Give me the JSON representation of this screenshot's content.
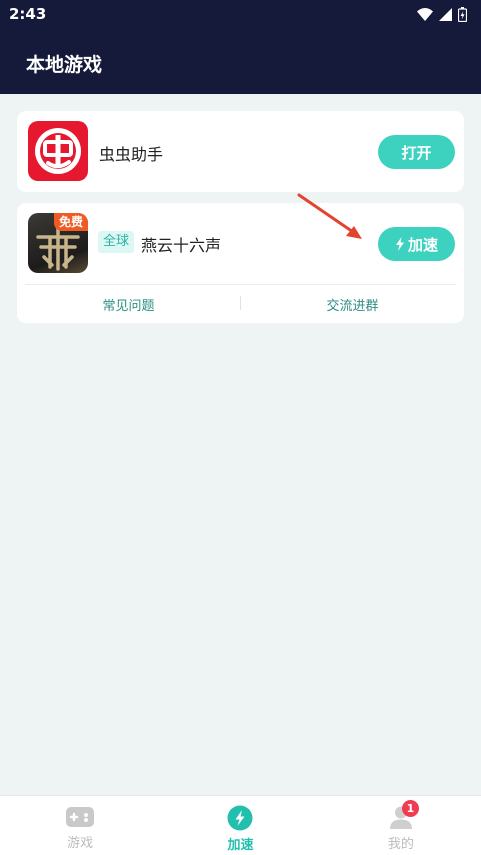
{
  "status_bar": {
    "time": "2:43",
    "icons": [
      "wifi-icon",
      "signal-icon",
      "battery-icon"
    ]
  },
  "header": {
    "title": "本地游戏"
  },
  "apps": [
    {
      "name": "虫虫助手",
      "action_label": "打开",
      "icon": "bug-assistant-logo"
    },
    {
      "name": "燕云十六声",
      "region_tag": "全球",
      "badge": "免费",
      "action_label": "加速",
      "action_icon": "lightning-icon",
      "icon": "game-cover"
    }
  ],
  "links": {
    "faq": "常见问题",
    "group": "交流进群"
  },
  "nav": [
    {
      "label": "游戏",
      "icon": "gamepad-icon"
    },
    {
      "label": "加速",
      "icon": "lightning-icon",
      "active": true
    },
    {
      "label": "我的",
      "icon": "user-icon",
      "badge": "1"
    }
  ],
  "colors": {
    "header_bg": "#161a3a",
    "accent": "#3dd1bf",
    "badge": "#f13b52",
    "free_badge": "#f25a24",
    "arrow": "#e2442f"
  }
}
